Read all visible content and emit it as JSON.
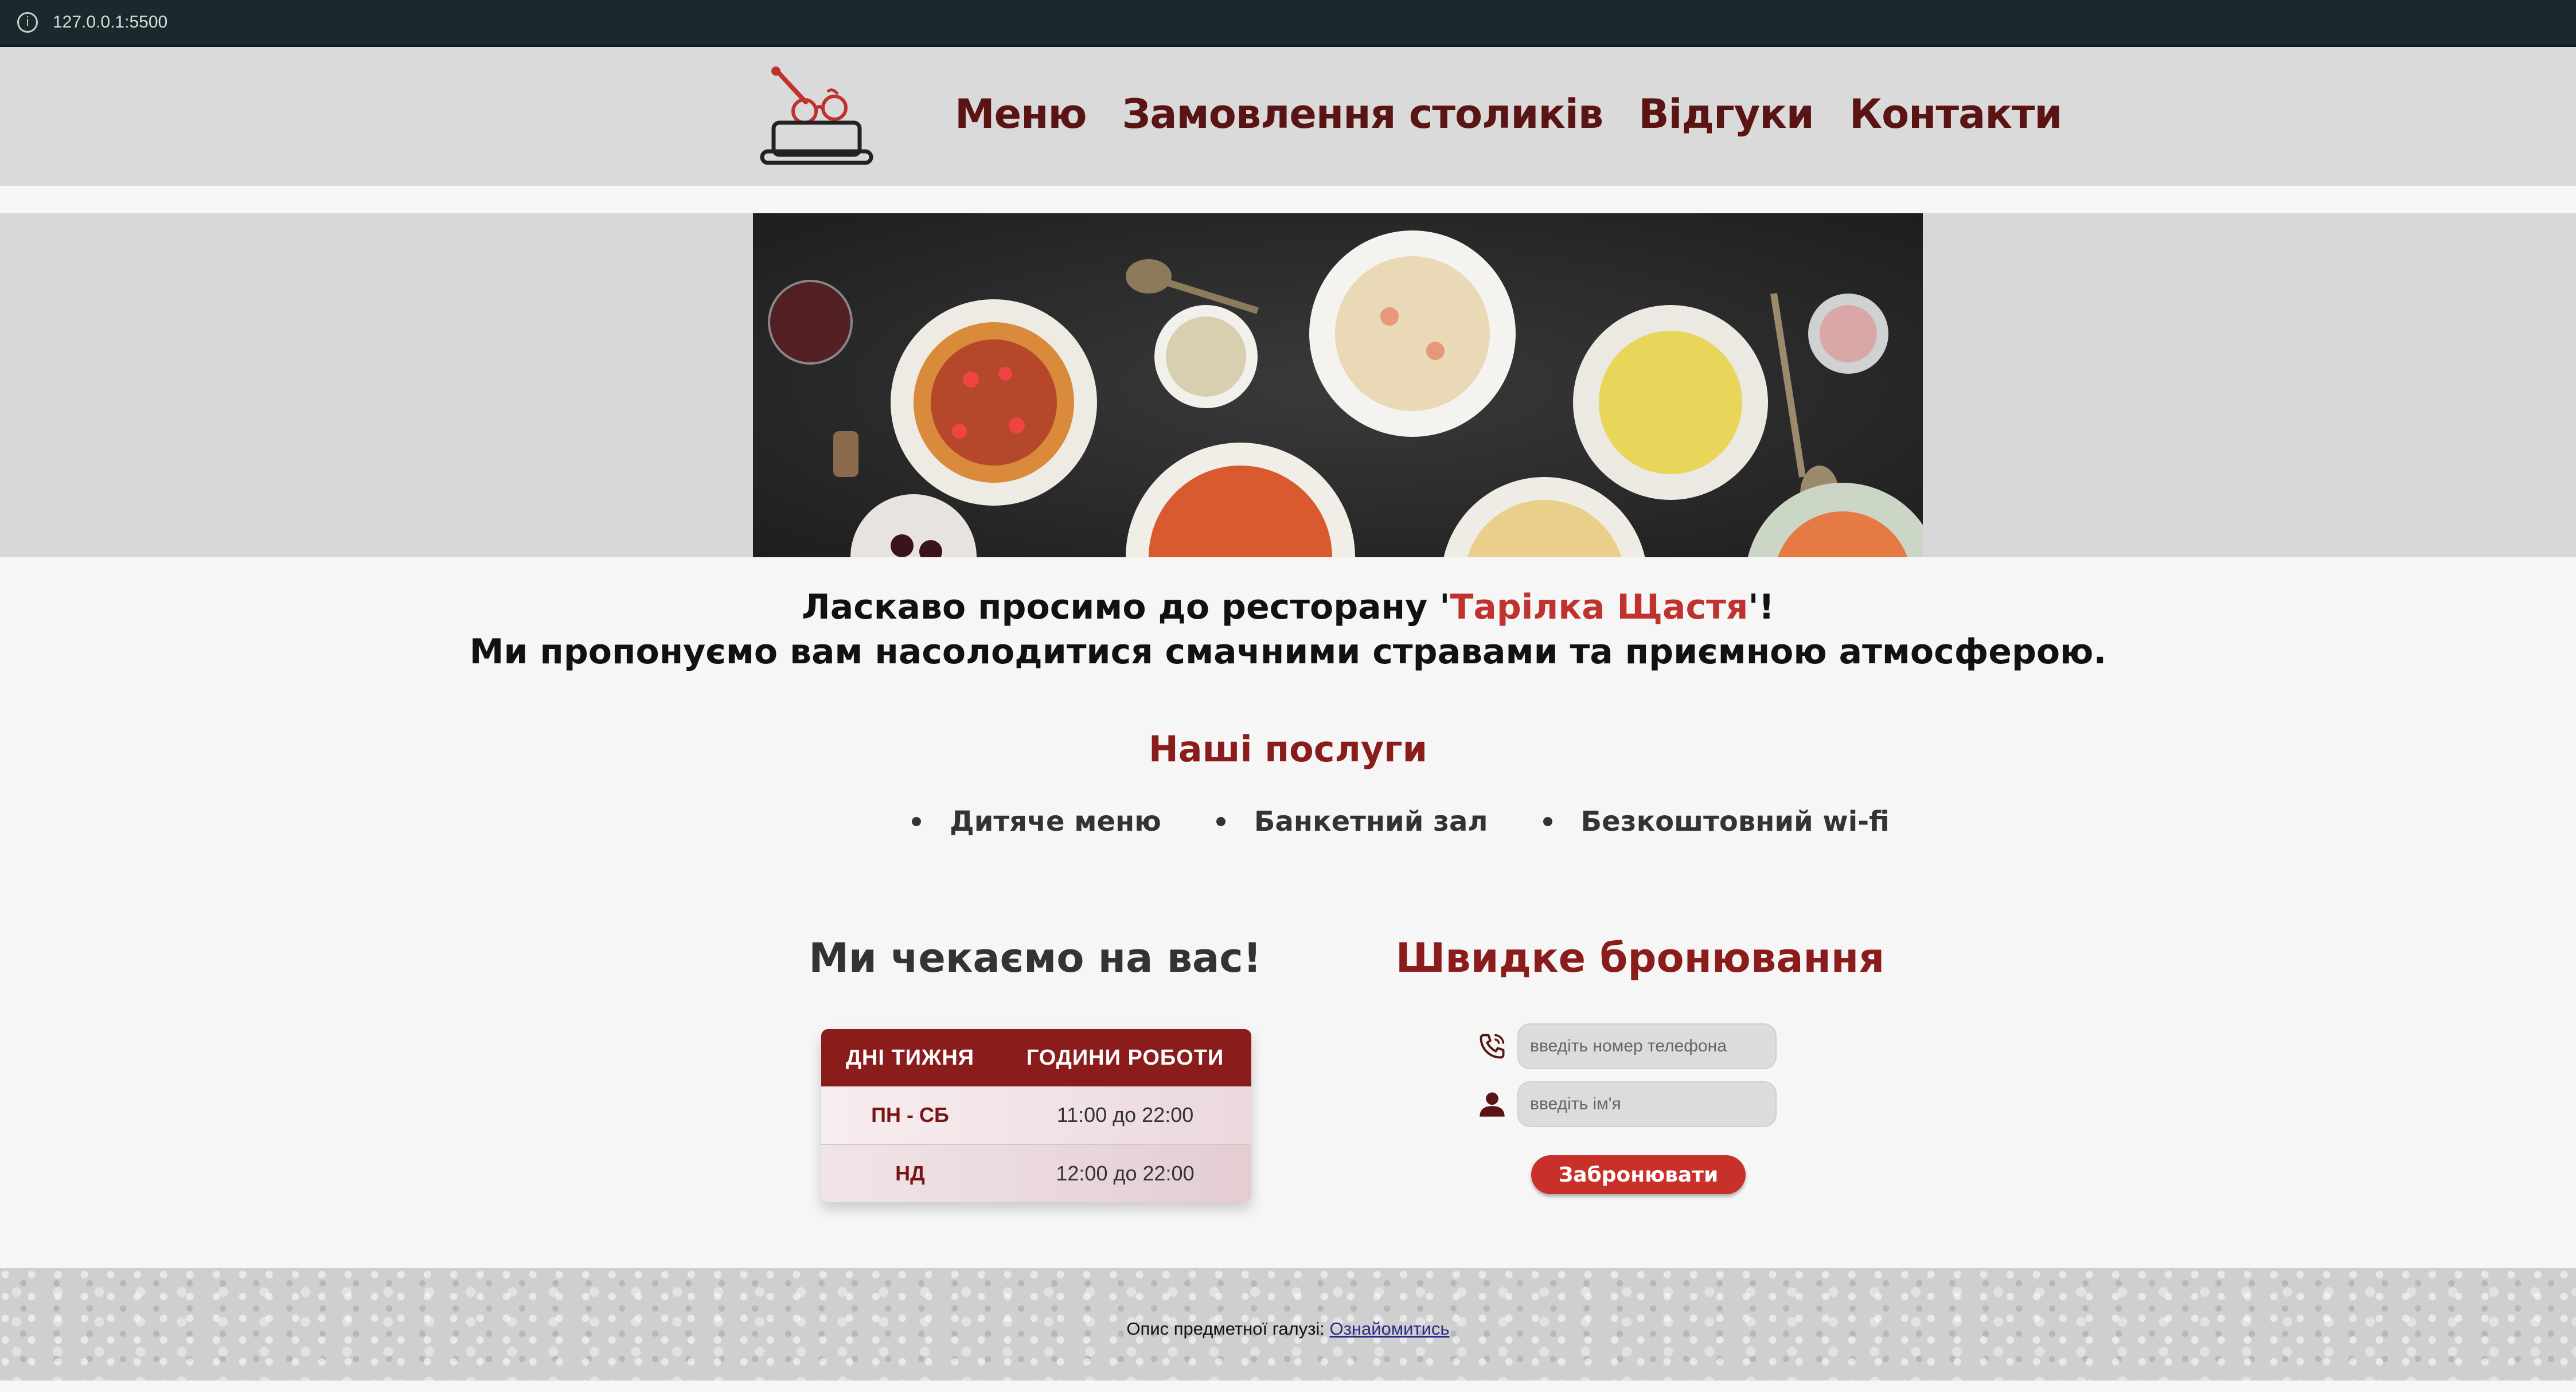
{
  "browser": {
    "url": "127.0.0.1:5500"
  },
  "nav": [
    "Меню",
    "Замовлення столиків",
    "Відгуки",
    "Контакти"
  ],
  "welcome": {
    "line1_before": "Ласкаво просимо до ресторану '",
    "brand": "Тарілка Щастя",
    "line1_after": "'!",
    "line2": "Ми пропонуємо вам насолодитися смачними стравами та приємною атмосферою."
  },
  "services": {
    "title": "Наші послуги",
    "items": [
      "Дитяче меню",
      "Банкетний зал",
      "Безкоштовний wi-fi"
    ]
  },
  "hours": {
    "title": "Ми чекаємо на вас!",
    "col_days": "ДНІ ТИЖНЯ",
    "col_hours": "ГОДИНИ РОБОТИ",
    "rows": [
      {
        "day": "ПН - СБ",
        "time": "11:00 до 22:00"
      },
      {
        "day": "НД",
        "time": "12:00 до 22:00"
      }
    ]
  },
  "booking": {
    "title": "Швидке бронювання",
    "phone_placeholder": "введіть номер телефона",
    "name_placeholder": "введіть ім'я",
    "button": "Забронювати"
  },
  "footer": {
    "text": "Опис предметної галузі: ",
    "link": "Ознайомитись"
  },
  "colors": {
    "accent": "#8b1c1c",
    "brand": "#c0322d",
    "button": "#c8302a"
  },
  "icons": [
    "info-icon",
    "logo-plate-icon",
    "phone-icon",
    "user-icon"
  ]
}
